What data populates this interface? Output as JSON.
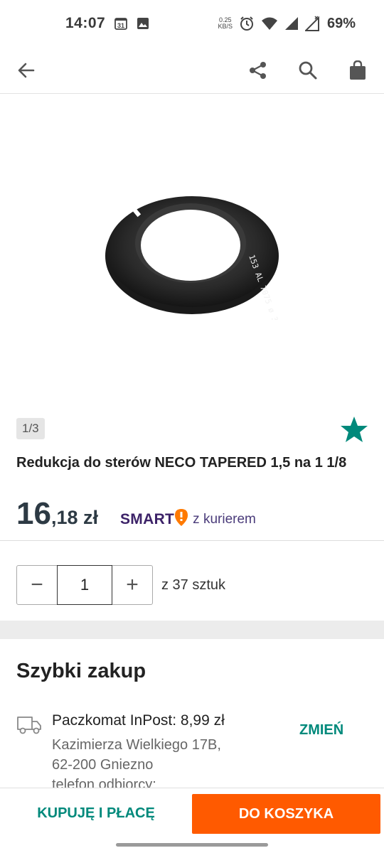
{
  "status_bar": {
    "time": "14:07",
    "calendar_day": "31",
    "net_speed_value": "0.25",
    "net_speed_unit": "KB/S",
    "battery": "69%"
  },
  "product": {
    "image_counter": "1/3",
    "title": "Redukcja do sterów NECO TAPERED 1,5 na 1 1/8",
    "price_main": "16",
    "price_rest": ",18 zł",
    "smart_label": "SMART",
    "smart_courier": "z kurierem",
    "image_engraving": "153  AL 7075  ø 30"
  },
  "quantity": {
    "value": "1",
    "minus": "−",
    "plus": "+",
    "stock_text": "z 37 sztuk"
  },
  "quick_buy": {
    "title": "Szybki zakup",
    "method": "Paczkomat InPost: 8,99 zł",
    "address_line1": "Kazimierza Wielkiego 17B,",
    "address_line2": "62-200 Gniezno",
    "address_line3": "telefon odbiorcy:",
    "change_label": "ZMIEŃ"
  },
  "actions": {
    "buy_now": "KUPUJĘ I PŁACĘ",
    "add_to_cart": "DO KOSZYKA"
  },
  "colors": {
    "accent_teal": "#00897b",
    "cart_orange": "#ff5a00",
    "smart_purple": "#3c2268",
    "smart_orange": "#ff7a00"
  },
  "icons": {
    "back": "arrow-left-icon",
    "share": "share-icon",
    "search": "search-icon",
    "cart": "shopping-bag-icon",
    "favorite": "star-icon",
    "delivery": "truck-icon"
  }
}
